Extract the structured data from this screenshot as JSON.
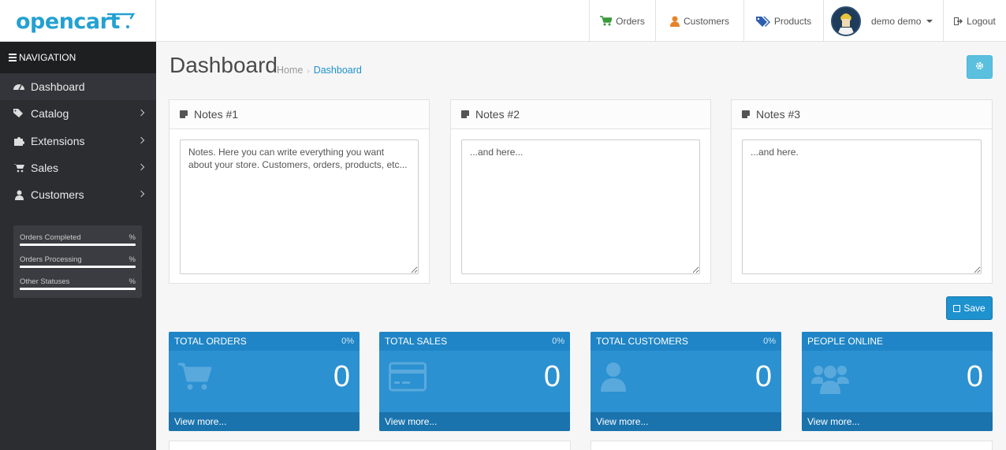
{
  "header": {
    "logo_text": "opencart",
    "orders": "Orders",
    "customers": "Customers",
    "products": "Products",
    "user": "demo demo",
    "logout": "Logout"
  },
  "sidebar": {
    "nav_title": "NAVIGATION",
    "items": [
      {
        "label": "Dashboard",
        "icon": "dashboard-icon"
      },
      {
        "label": "Catalog",
        "icon": "tags-icon"
      },
      {
        "label": "Extensions",
        "icon": "puzzle-icon"
      },
      {
        "label": "Sales",
        "icon": "cart-icon"
      },
      {
        "label": "Customers",
        "icon": "user-icon"
      }
    ],
    "stats": [
      {
        "label": "Orders Completed",
        "pct": "%"
      },
      {
        "label": "Orders Processing",
        "pct": "%"
      },
      {
        "label": "Other Statuses",
        "pct": "%"
      }
    ]
  },
  "page": {
    "title": "Dashboard",
    "breadcrumb_home": "Home",
    "breadcrumb_current": "Dashboard"
  },
  "notes": [
    {
      "title": "Notes #1",
      "text": "Notes. Here you can write everything you want about your store. Customers, orders, products, etc..."
    },
    {
      "title": "Notes #2",
      "text": "...and here..."
    },
    {
      "title": "Notes #3",
      "text": "...and here."
    }
  ],
  "save_label": "Save",
  "tiles": [
    {
      "title": "TOTAL ORDERS",
      "pct": "0%",
      "value": "0",
      "link": "View more..."
    },
    {
      "title": "TOTAL SALES",
      "pct": "0%",
      "value": "0",
      "link": "View more..."
    },
    {
      "title": "TOTAL CUSTOMERS",
      "pct": "0%",
      "value": "0",
      "link": "View more..."
    },
    {
      "title": "PEOPLE ONLINE",
      "pct": "",
      "value": "0",
      "link": "View more..."
    }
  ],
  "colors": {
    "brand": "#23a1d1",
    "sidebar_bg": "#2b2d31",
    "tile_bg": "#2b91d1",
    "primary_button": "#1e91cf",
    "info_button": "#5bc0de"
  }
}
